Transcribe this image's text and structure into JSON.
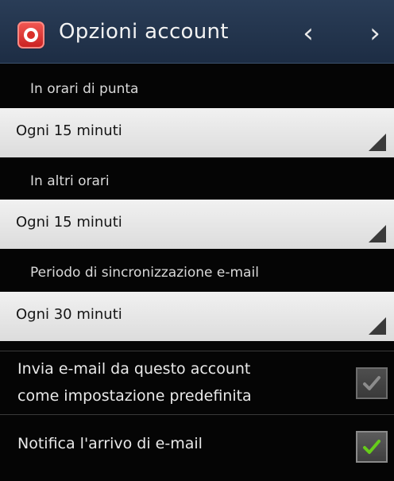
{
  "header": {
    "title": "Opzioni account",
    "prev_icon": "‹",
    "next_icon": "›"
  },
  "sync": {
    "peak": {
      "label": "In orari di punta",
      "value": "Ogni 15 minuti"
    },
    "offpeak": {
      "label": "In altri orari",
      "value": "Ogni 15 minuti"
    },
    "email_period": {
      "label": "Periodo di sincronizzazione e-mail",
      "value": "Ogni 30 minuti"
    }
  },
  "options": {
    "default_account": {
      "line1": "Invia e-mail da questo account",
      "line2": "come impostazione predefinita",
      "checked": true,
      "enabled": false
    },
    "notify": {
      "label": "Notifica l'arrivo di e-mail",
      "checked": true,
      "enabled": true
    }
  },
  "colors": {
    "title_bar": "#1d2d44",
    "check_enabled": "#66cc1a",
    "check_disabled": "#8c8c8c"
  }
}
